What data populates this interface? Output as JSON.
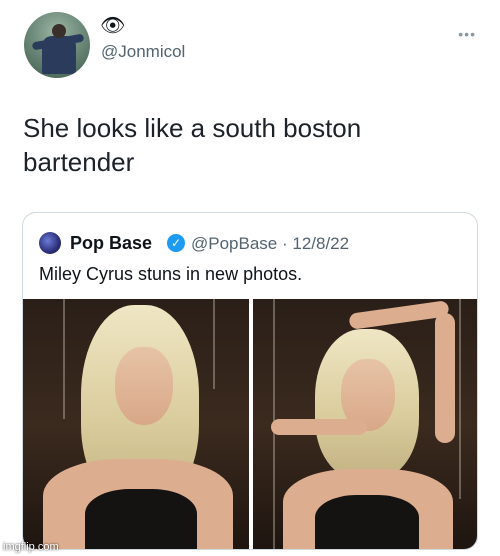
{
  "tweet": {
    "eye_emoji": "👁",
    "handle": "@Jonmicol",
    "more": "•••",
    "text": "She looks like a south boston bartender"
  },
  "quote": {
    "name": "Pop Base",
    "verified_mark": "✓",
    "handle_date": "@PopBase · 12/8/22",
    "text": "Miley Cyrus stuns in new photos."
  },
  "watermark": "imgflip.com",
  "colors": {
    "verified_blue": "#1d9bf0",
    "secondary_text": "#536471",
    "border": "#cfd9de"
  }
}
